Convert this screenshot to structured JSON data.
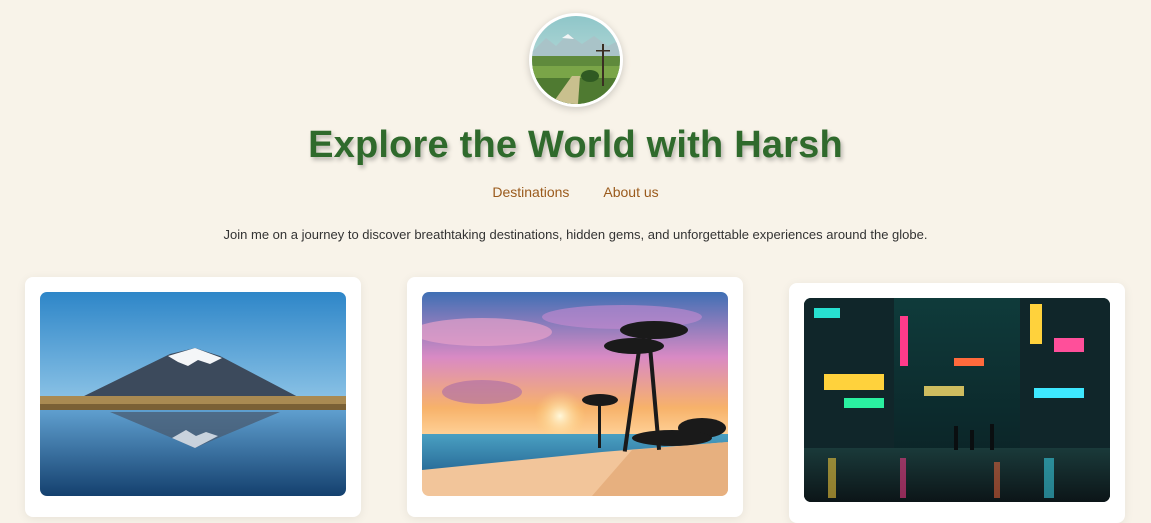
{
  "header": {
    "title": "Explore the World with Harsh",
    "avatar_icon": "profile-landscape-photo"
  },
  "nav": {
    "items": [
      {
        "label": "Destinations"
      },
      {
        "label": "About us"
      }
    ]
  },
  "intro": {
    "tagline": "Join me on a journey to discover breathtaking destinations, hidden gems, and unforgettable experiences around the globe."
  },
  "cards": [
    {
      "image": "snow-mountain-lake-reflection-photo"
    },
    {
      "image": "tropical-beach-sunset-palms-photo"
    },
    {
      "image": "neon-city-street-night-photo"
    }
  ],
  "colors": {
    "background": "#f8f3e9",
    "title": "#2f6a2c",
    "nav_link": "#9a5a1c",
    "text": "#333333"
  }
}
